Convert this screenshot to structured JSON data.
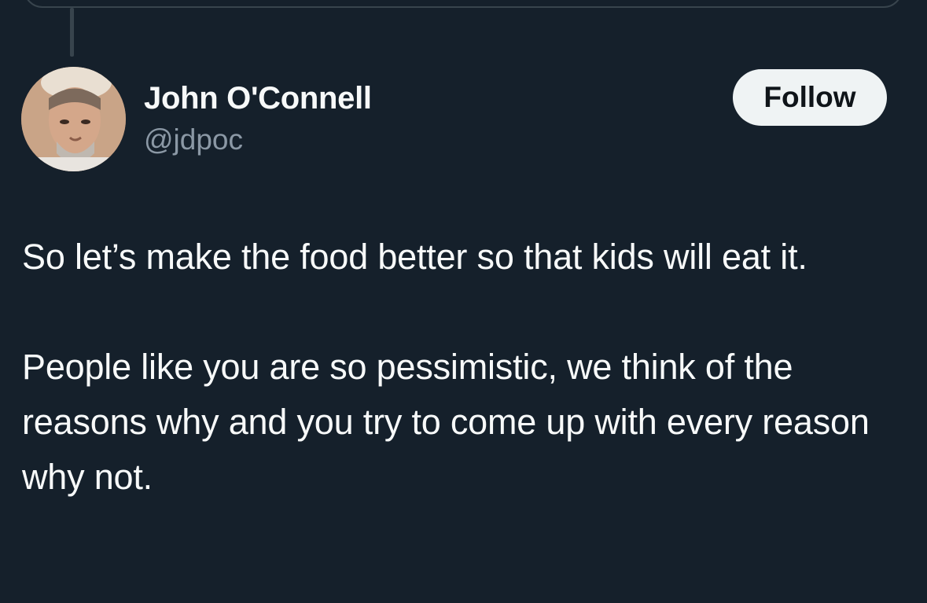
{
  "author": {
    "display_name": "John O'Connell",
    "handle": "@jdpoc"
  },
  "actions": {
    "follow_label": "Follow"
  },
  "tweet": {
    "paragraphs": [
      "So let’s make the food better so that kids will eat it.",
      "People like you are so pessimistic, we think of the reasons why and you try to come up with every reason why not."
    ]
  },
  "theme": {
    "background": "#15202b",
    "text_primary": "#f7f9f9",
    "text_secondary": "#8b98a5",
    "border": "#38444d",
    "follow_button_bg": "#eff3f4",
    "follow_button_text": "#0f1419"
  }
}
